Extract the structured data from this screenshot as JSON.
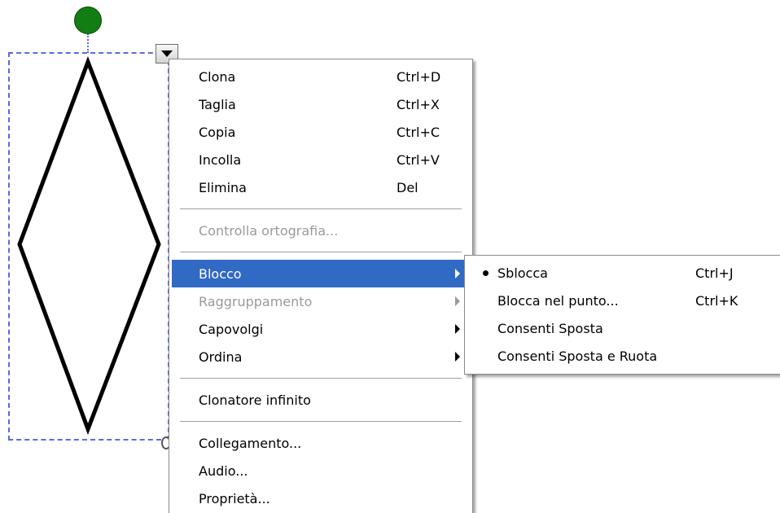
{
  "context_menu": {
    "items": [
      {
        "label": "Clona",
        "shortcut": "Ctrl+D"
      },
      {
        "label": "Taglia",
        "shortcut": "Ctrl+X"
      },
      {
        "label": "Copia",
        "shortcut": "Ctrl+C"
      },
      {
        "label": "Incolla",
        "shortcut": "Ctrl+V"
      },
      {
        "label": "Elimina",
        "shortcut": "Del"
      },
      {
        "label": "Controlla ortografia..."
      },
      {
        "label": "Blocco"
      },
      {
        "label": "Raggruppamento"
      },
      {
        "label": "Capovolgi"
      },
      {
        "label": "Ordina"
      },
      {
        "label": "Clonatore infinito"
      },
      {
        "label": "Collegamento..."
      },
      {
        "label": "Audio..."
      },
      {
        "label": "Proprietà..."
      }
    ]
  },
  "submenu": {
    "items": [
      {
        "label": "Sblocca",
        "shortcut": "Ctrl+J"
      },
      {
        "label": "Blocca nel punto...",
        "shortcut": "Ctrl+K"
      },
      {
        "label": "Consenti Sposta"
      },
      {
        "label": "Consenti Sposta e Ruota"
      }
    ]
  },
  "colors": {
    "highlight": "#316ac5",
    "disabled_text": "#9a9a9a",
    "selection_border": "#5c6ae0",
    "rotate_handle": "#127d12"
  },
  "icons": {
    "menu_trigger": "dropdown-arrow-icon",
    "submenu_arrow": "chevron-right-icon",
    "checked_bullet": "bullet-icon"
  }
}
